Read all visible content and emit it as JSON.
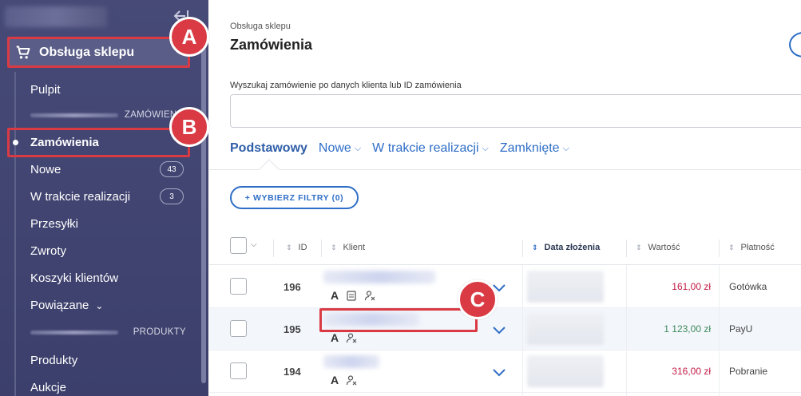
{
  "sidebar": {
    "shop_label": "Obsługa sklepu",
    "items": [
      {
        "label": "Pulpit"
      },
      {
        "label": "Zamówienia"
      },
      {
        "label": "Nowe",
        "badge": "43"
      },
      {
        "label": "W trakcie realizacji",
        "badge": "3"
      },
      {
        "label": "Przesyłki"
      },
      {
        "label": "Zwroty"
      },
      {
        "label": "Koszyki klientów"
      },
      {
        "label": "Powiązane"
      },
      {
        "label": "Produkty"
      },
      {
        "label": "Aukcje"
      }
    ],
    "sections": {
      "orders": "ZAMÓWIENIA",
      "products": "PRODUKTY"
    }
  },
  "markers": {
    "a": "A",
    "b": "B",
    "c": "C"
  },
  "header": {
    "breadcrumb": "Obsługa sklepu",
    "title": "Zamówienia"
  },
  "search": {
    "label": "Wyszukaj zamówienie po danych klienta lub ID zamówienia",
    "value": ""
  },
  "tabs": [
    {
      "label": "Podstawowy"
    },
    {
      "label": "Nowe"
    },
    {
      "label": "W trakcie realizacji"
    },
    {
      "label": "Zamknięte"
    }
  ],
  "filter_button": "+ WYBIERZ FILTRY (0)",
  "table": {
    "columns": {
      "id": "ID",
      "client": "Klient",
      "date": "Data złożenia",
      "value": "Wartość",
      "payment": "Płatność"
    },
    "rows": [
      {
        "id": "196",
        "value": "161,00 zł",
        "payment": "Gotówka"
      },
      {
        "id": "195",
        "value": "1 123,00 zł",
        "payment": "PayU"
      },
      {
        "id": "194",
        "value": "316,00 zł",
        "payment": "Pobranie"
      }
    ]
  },
  "colors": {
    "sidebar": "#434672",
    "accent": "#2f6ec6",
    "marker": "#d93a43",
    "value_red": "#c21c46",
    "value_green": "#3e8a5a"
  }
}
